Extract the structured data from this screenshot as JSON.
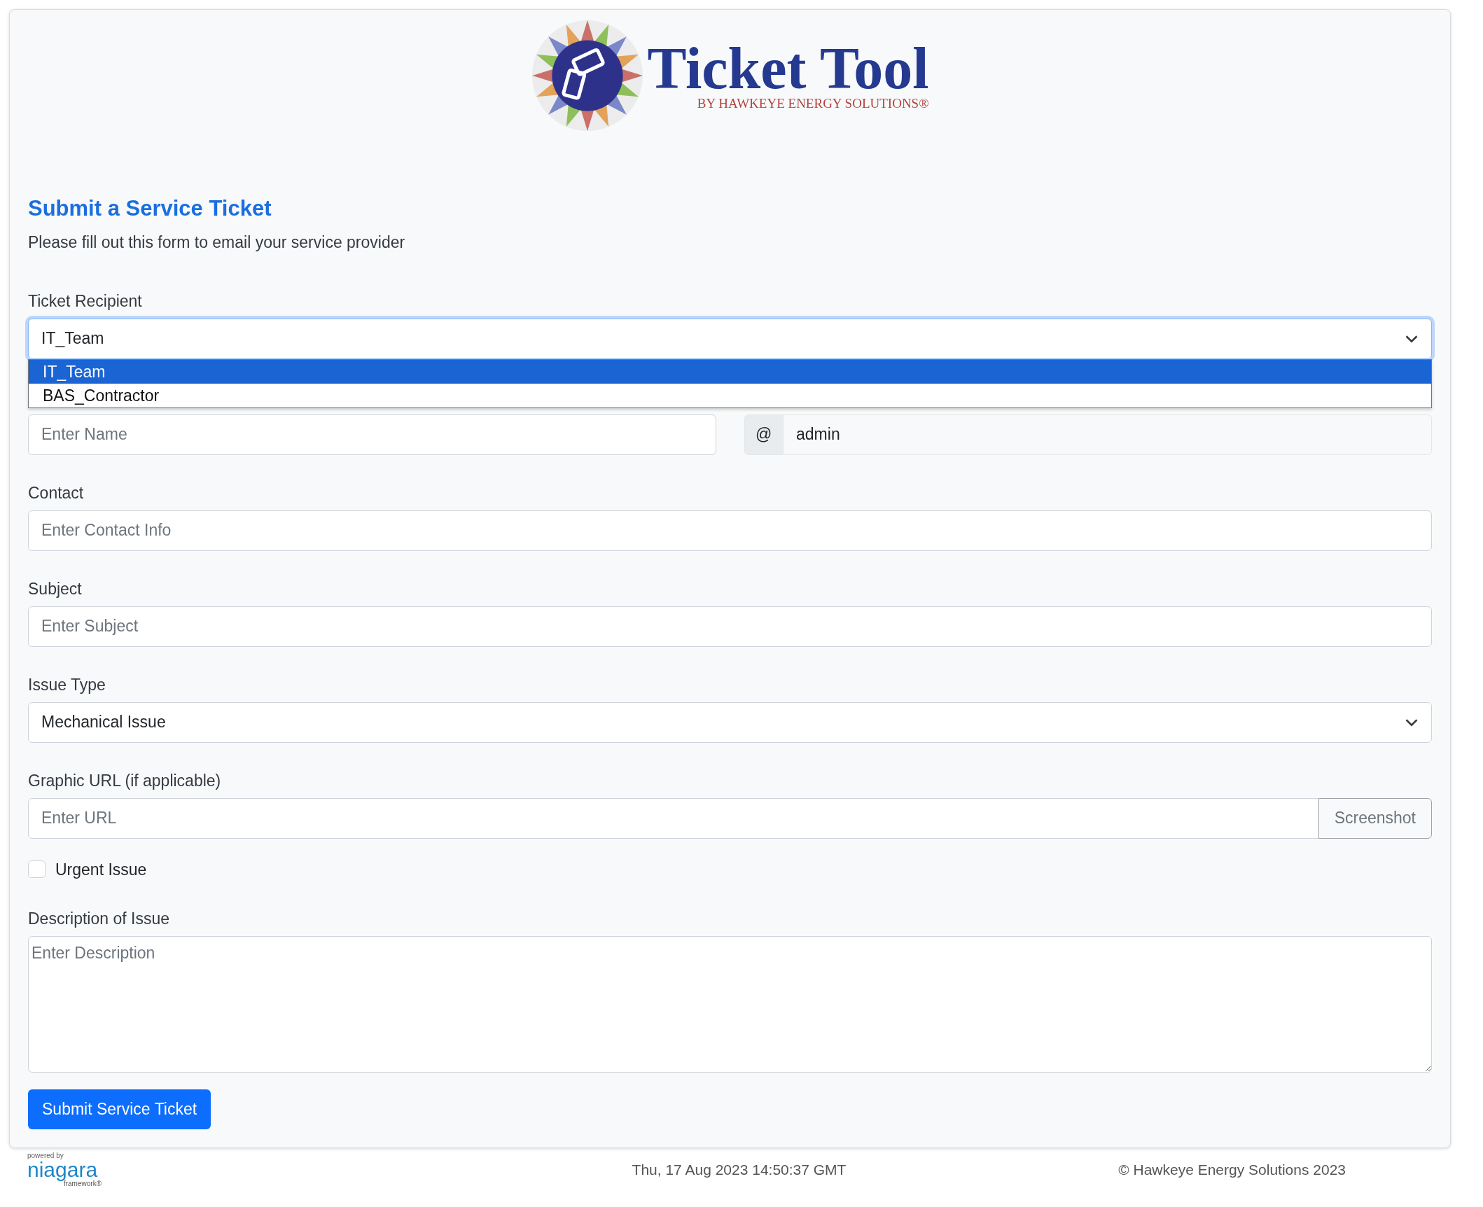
{
  "logo": {
    "title": "Ticket Tool",
    "tagline": "BY HAWKEYE ENERGY SOLUTIONS®"
  },
  "heading": "Submit a Service Ticket",
  "intro": "Please fill out this form to email your service provider",
  "recipient": {
    "label": "Ticket Recipient",
    "value": "IT_Team",
    "expanded": true,
    "options": [
      {
        "label": "IT_Team",
        "selected": true
      },
      {
        "label": "BAS_Contractor",
        "selected": false
      }
    ]
  },
  "name": {
    "placeholder": "Enter Name"
  },
  "user": {
    "prefix": "@",
    "value": "admin"
  },
  "contact": {
    "label": "Contact",
    "placeholder": "Enter Contact Info"
  },
  "subject": {
    "label": "Subject",
    "placeholder": "Enter Subject"
  },
  "issue_type": {
    "label": "Issue Type",
    "value": "Mechanical Issue"
  },
  "graphic_url": {
    "label": "Graphic URL (if applicable)",
    "placeholder": "Enter URL",
    "button": "Screenshot"
  },
  "urgent": {
    "label": "Urgent Issue",
    "checked": false
  },
  "description": {
    "label": "Description of Issue",
    "placeholder": "Enter Description"
  },
  "submit": "Submit Service Ticket",
  "footer": {
    "powered_by": "powered by",
    "brand": "niagara",
    "brand_sub": "framework®",
    "timestamp": "Thu, 17 Aug 2023 14:50:37 GMT",
    "copyright": "© Hawkeye Energy Solutions 2023"
  }
}
